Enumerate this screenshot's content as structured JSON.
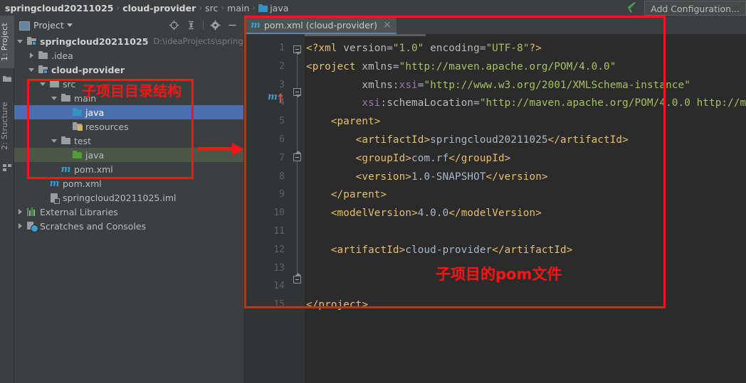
{
  "navbar": {
    "breadcrumbs": [
      {
        "label": "springcloud20211025",
        "bold": true,
        "icon": null
      },
      {
        "label": "cloud-provider",
        "bold": true,
        "icon": null
      },
      {
        "label": "src",
        "bold": false,
        "icon": null
      },
      {
        "label": "main",
        "bold": false,
        "icon": null
      },
      {
        "label": "java",
        "bold": false,
        "icon": "blue-folder-icon"
      }
    ],
    "separator": "›",
    "run_icon": "run-configuration-arrow-icon",
    "add_configuration_label": "Add Configuration..."
  },
  "side_rail": {
    "tabs": [
      {
        "label": "1: Project",
        "icon": "project-icon",
        "active": true
      },
      {
        "label": "2: Structure",
        "icon": "structure-icon",
        "active": false
      }
    ]
  },
  "project_panel": {
    "title": "Project",
    "dropdown_icon": "chevron-down-icon",
    "window_icon": "project-window-icon",
    "tools": [
      {
        "name": "locate-in-tree-icon",
        "glyph": "target"
      },
      {
        "name": "collapse-all-icon",
        "glyph": "collapse"
      },
      {
        "name": "settings-gear-icon",
        "glyph": "gear"
      },
      {
        "name": "hide-panel-icon",
        "glyph": "minus"
      }
    ],
    "tree": [
      {
        "indent": 0,
        "twisty": "open",
        "icon": "module-folder-icon",
        "label": "springcloud20211025",
        "bold": true,
        "hint": "D:\\ideaProjects\\springclou",
        "state": "normal"
      },
      {
        "indent": 1,
        "twisty": "closed",
        "icon": "gray-folder-icon",
        "label": ".idea",
        "bold": false,
        "hint": "",
        "state": "normal"
      },
      {
        "indent": 1,
        "twisty": "open",
        "icon": "module-folder-icon",
        "label": "cloud-provider",
        "bold": true,
        "hint": "",
        "state": "normal"
      },
      {
        "indent": 2,
        "twisty": "open",
        "icon": "gray-folder-icon",
        "label": "src",
        "bold": false,
        "hint": "",
        "state": "normal"
      },
      {
        "indent": 3,
        "twisty": "open",
        "icon": "gray-folder-icon",
        "label": "main",
        "bold": false,
        "hint": "",
        "state": "normal"
      },
      {
        "indent": 4,
        "twisty": "none",
        "icon": "blue-source-folder-icon",
        "label": "java",
        "bold": false,
        "hint": "",
        "state": "selected"
      },
      {
        "indent": 4,
        "twisty": "none",
        "icon": "resources-folder-icon",
        "label": "resources",
        "bold": false,
        "hint": "",
        "state": "normal"
      },
      {
        "indent": 3,
        "twisty": "open",
        "icon": "gray-folder-icon",
        "label": "test",
        "bold": false,
        "hint": "",
        "state": "normal"
      },
      {
        "indent": 4,
        "twisty": "none",
        "icon": "green-source-folder-icon",
        "label": "java",
        "bold": false,
        "hint": "",
        "state": "test-selected"
      },
      {
        "indent": 3,
        "twisty": "none",
        "icon": "maven-pom-icon",
        "label": "pom.xml",
        "bold": false,
        "hint": "",
        "state": "normal"
      },
      {
        "indent": 2,
        "twisty": "none",
        "icon": "maven-pom-icon",
        "label": "pom.xml",
        "bold": false,
        "hint": "",
        "state": "normal"
      },
      {
        "indent": 2,
        "twisty": "none",
        "icon": "iml-file-icon",
        "label": "springcloud20211025.iml",
        "bold": false,
        "hint": "",
        "state": "normal"
      },
      {
        "indent": 0,
        "twisty": "closed",
        "icon": "external-libraries-icon",
        "label": "External Libraries",
        "bold": false,
        "hint": "",
        "state": "normal"
      },
      {
        "indent": 0,
        "twisty": "closed",
        "icon": "scratches-icon",
        "label": "Scratches and Consoles",
        "bold": false,
        "hint": "",
        "state": "normal"
      }
    ]
  },
  "editor": {
    "tab": {
      "label": "pom.xml (cloud-provider)",
      "icon": "maven-file-icon",
      "close_icon": "close-icon"
    },
    "gutter_marker": {
      "line": 5,
      "icon": "maven-parent-navigate-icon"
    },
    "lines": [
      {
        "num": "1",
        "fragments": [
          {
            "t": "<?xml ",
            "c": "t-pi"
          },
          {
            "t": "version",
            "c": "t-attr"
          },
          {
            "t": "=",
            "c": "t-txt"
          },
          {
            "t": "\"1.0\"",
            "c": "t-val"
          },
          {
            "t": " ",
            "c": "t-txt"
          },
          {
            "t": "encoding",
            "c": "t-attr"
          },
          {
            "t": "=",
            "c": "t-txt"
          },
          {
            "t": "\"UTF-8\"",
            "c": "t-val"
          },
          {
            "t": "?>",
            "c": "t-pi"
          }
        ]
      },
      {
        "num": "2",
        "fragments": [
          {
            "t": "<project ",
            "c": "t-tag"
          },
          {
            "t": "xmlns",
            "c": "t-attr"
          },
          {
            "t": "=",
            "c": "t-txt"
          },
          {
            "t": "\"http://maven.apache.org/POM/4.0.0\"",
            "c": "t-val"
          }
        ]
      },
      {
        "num": "3",
        "fragments": [
          {
            "t": "         ",
            "c": "t-txt"
          },
          {
            "t": "xmlns",
            "c": "t-attr"
          },
          {
            "t": ":",
            "c": "t-txt"
          },
          {
            "t": "xsi",
            "c": "t-ns"
          },
          {
            "t": "=",
            "c": "t-txt"
          },
          {
            "t": "\"http://www.w3.org/2001/XMLSchema-instance\"",
            "c": "t-val"
          }
        ]
      },
      {
        "num": "4",
        "fragments": [
          {
            "t": "         ",
            "c": "t-txt"
          },
          {
            "t": "xsi",
            "c": "t-ns"
          },
          {
            "t": ":",
            "c": "t-txt"
          },
          {
            "t": "schemaLocation",
            "c": "t-attr"
          },
          {
            "t": "=",
            "c": "t-txt"
          },
          {
            "t": "\"http://maven.apache.org/POM/4.0.0 http://m",
            "c": "t-val"
          }
        ]
      },
      {
        "num": "5",
        "fragments": [
          {
            "t": "    ",
            "c": "t-txt"
          },
          {
            "t": "<parent>",
            "c": "t-tag"
          }
        ]
      },
      {
        "num": "6",
        "fragments": [
          {
            "t": "        ",
            "c": "t-txt"
          },
          {
            "t": "<artifactId>",
            "c": "t-tag"
          },
          {
            "t": "springcloud20211025",
            "c": "t-txt"
          },
          {
            "t": "</artifactId>",
            "c": "t-tag"
          }
        ]
      },
      {
        "num": "7",
        "fragments": [
          {
            "t": "        ",
            "c": "t-txt"
          },
          {
            "t": "<groupId>",
            "c": "t-tag"
          },
          {
            "t": "com.rf",
            "c": "t-txt"
          },
          {
            "t": "</groupId>",
            "c": "t-tag"
          }
        ]
      },
      {
        "num": "8",
        "fragments": [
          {
            "t": "        ",
            "c": "t-txt"
          },
          {
            "t": "<version>",
            "c": "t-tag"
          },
          {
            "t": "1.0-SNAPSHOT",
            "c": "t-txt"
          },
          {
            "t": "</version>",
            "c": "t-tag"
          }
        ]
      },
      {
        "num": "9",
        "fragments": [
          {
            "t": "    ",
            "c": "t-txt"
          },
          {
            "t": "</parent>",
            "c": "t-tag"
          }
        ]
      },
      {
        "num": "10",
        "fragments": [
          {
            "t": "    ",
            "c": "t-txt"
          },
          {
            "t": "<modelVersion>",
            "c": "t-tag"
          },
          {
            "t": "4.0.0",
            "c": "t-txt"
          },
          {
            "t": "</modelVersion>",
            "c": "t-tag"
          }
        ]
      },
      {
        "num": "11",
        "fragments": []
      },
      {
        "num": "12",
        "fragments": [
          {
            "t": "    ",
            "c": "t-txt"
          },
          {
            "t": "<artifactId>",
            "c": "t-tag"
          },
          {
            "t": "cloud-provider",
            "c": "t-txt"
          },
          {
            "t": "</artifactId>",
            "c": "t-tag"
          }
        ]
      },
      {
        "num": "13",
        "fragments": []
      },
      {
        "num": "14",
        "fragments": []
      },
      {
        "num": "15",
        "fragments": [
          {
            "t": "</project>",
            "c": "t-tag"
          }
        ]
      }
    ]
  },
  "annotations": {
    "tree_box_label": "子项目目录结构",
    "editor_box_label": "子项目的pom文件",
    "arrow_name": "red-pointer-arrow",
    "color": "#fe1414"
  }
}
